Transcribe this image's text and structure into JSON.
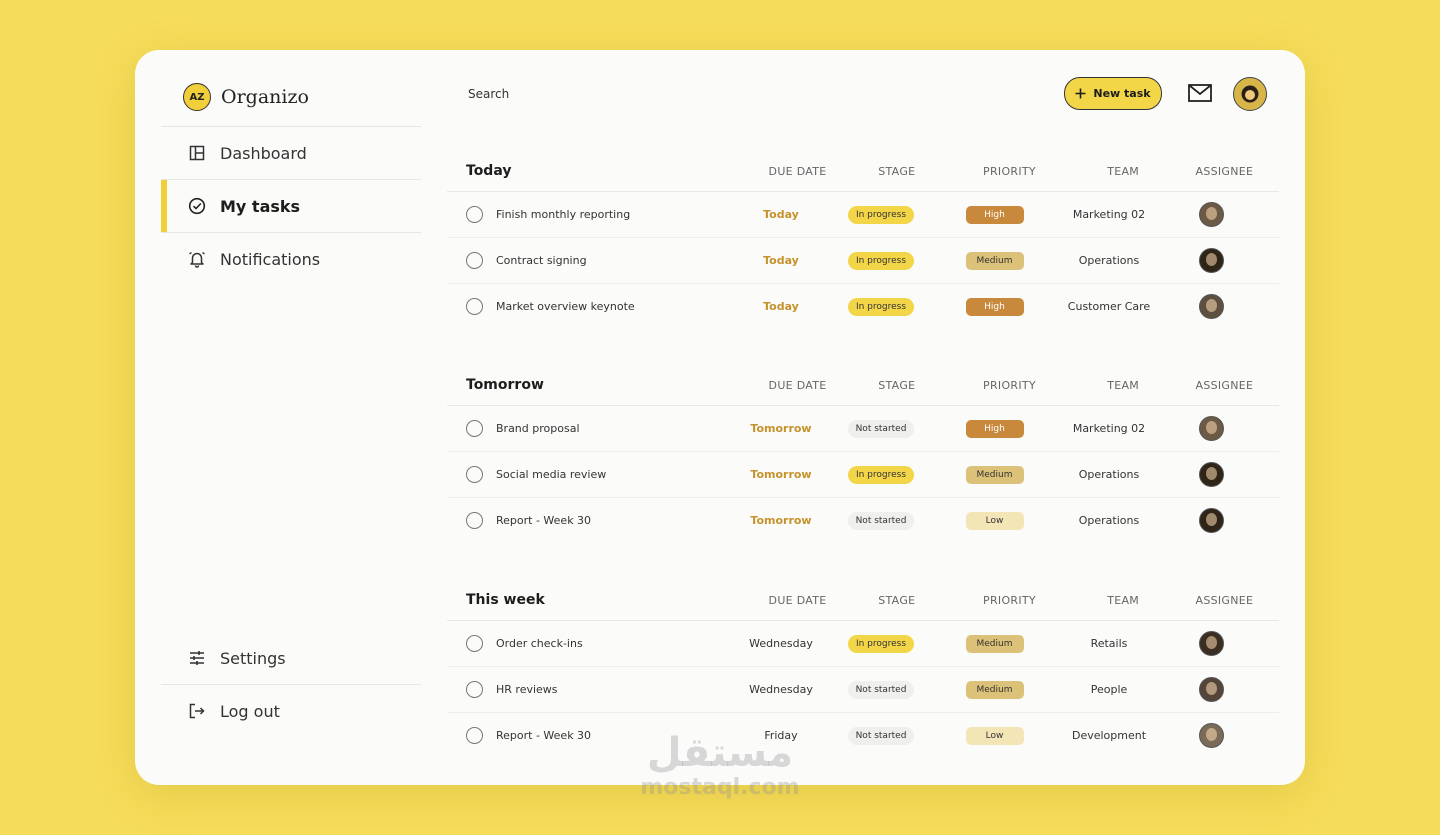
{
  "app": {
    "name": "Organizo",
    "logo_text": "AZ"
  },
  "sidebar": {
    "items": [
      {
        "label": "Dashboard",
        "icon": "dashboard-icon",
        "active": false
      },
      {
        "label": "My tasks",
        "icon": "check-circle-icon",
        "active": true
      },
      {
        "label": "Notifications",
        "icon": "bell-icon",
        "active": false
      }
    ],
    "bottom_items": [
      {
        "label": "Settings",
        "icon": "sliders-icon"
      },
      {
        "label": "Log out",
        "icon": "logout-icon"
      }
    ]
  },
  "header": {
    "search_label": "Search",
    "new_task_label": "New task"
  },
  "columns": {
    "due_date": "DUE DATE",
    "stage": "STAGE",
    "priority": "PRIORITY",
    "team": "TEAM",
    "assignee": "ASSIGNEE"
  },
  "sections": [
    {
      "title": "Today",
      "rows": [
        {
          "task": "Finish monthly reporting",
          "due": "Today",
          "due_accent": true,
          "stage": "In progress",
          "priority": "High",
          "team": "Marketing 02",
          "avatar_color": "#6b5a44"
        },
        {
          "task": "Contract signing",
          "due": "Today",
          "due_accent": true,
          "stage": "In progress",
          "priority": "Medium",
          "team": "Operations",
          "avatar_color": "#2f2418"
        },
        {
          "task": "Market overview keynote",
          "due": "Today",
          "due_accent": true,
          "stage": "In progress",
          "priority": "High",
          "team": "Customer Care",
          "avatar_color": "#5d5040"
        }
      ]
    },
    {
      "title": "Tomorrow",
      "rows": [
        {
          "task": "Brand proposal",
          "due": "Tomorrow",
          "due_accent": true,
          "stage": "Not started",
          "priority": "High",
          "team": "Marketing 02",
          "avatar_color": "#6b5a44"
        },
        {
          "task": "Social media review",
          "due": "Tomorrow",
          "due_accent": true,
          "stage": "In progress",
          "priority": "Medium",
          "team": "Operations",
          "avatar_color": "#2f2418"
        },
        {
          "task": "Report - Week 30",
          "due": "Tomorrow",
          "due_accent": true,
          "stage": "Not started",
          "priority": "Low",
          "team": "Operations",
          "avatar_color": "#2f2418"
        }
      ]
    },
    {
      "title": "This week",
      "rows": [
        {
          "task": "Order check-ins",
          "due": "Wednesday",
          "due_accent": false,
          "stage": "In progress",
          "priority": "Medium",
          "team": "Retails",
          "avatar_color": "#3a2d22"
        },
        {
          "task": "HR reviews",
          "due": "Wednesday",
          "due_accent": false,
          "stage": "Not started",
          "priority": "Medium",
          "team": "People",
          "avatar_color": "#54453a"
        },
        {
          "task": "Report - Week 30",
          "due": "Friday",
          "due_accent": false,
          "stage": "Not started",
          "priority": "Low",
          "team": "Development",
          "avatar_color": "#7a6a58"
        }
      ]
    }
  ],
  "watermark": {
    "arabic": "مستقل",
    "latin": "mostaql.com"
  },
  "colors": {
    "background": "#f5dc5a",
    "accent": "#f3d548",
    "high": "#c9893c",
    "medium": "#dcc178",
    "low": "#f4e5b6",
    "due_accent": "#c6922c"
  }
}
